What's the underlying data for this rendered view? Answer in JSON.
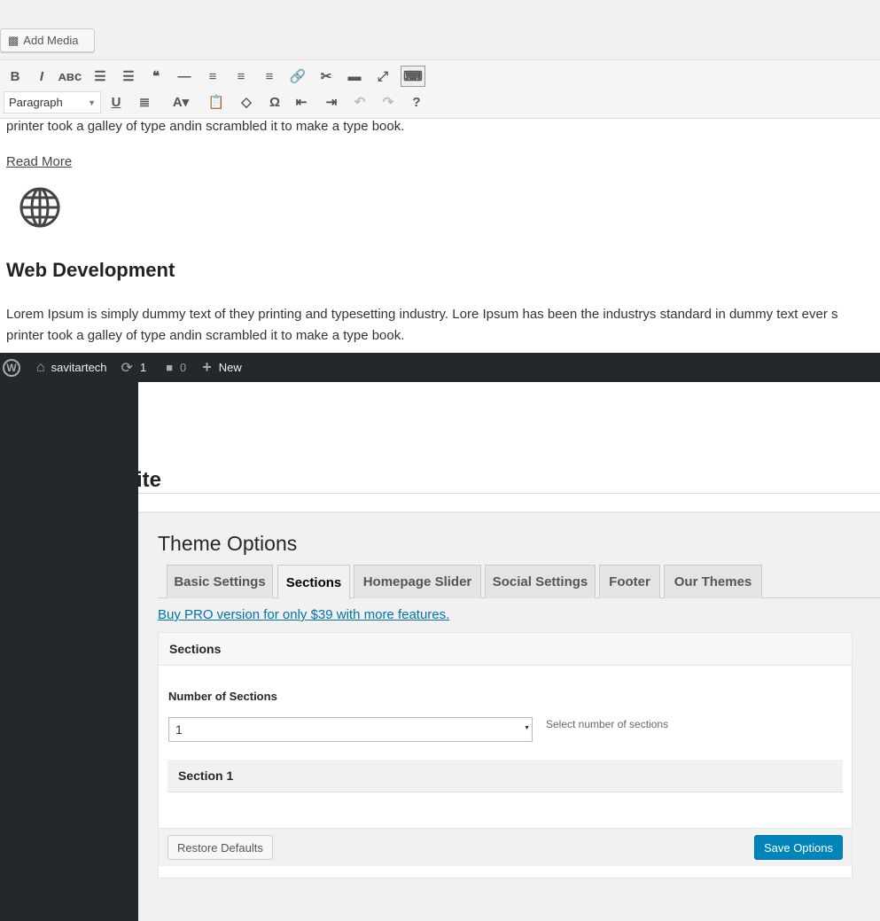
{
  "editor": {
    "add_media": "Add Media",
    "format_select": "Paragraph",
    "toolbar_row1": [
      "bold-icon",
      "italic-icon",
      "strikethrough-icon",
      "bullet-list-icon",
      "numbered-list-icon",
      "blockquote-icon",
      "horizontal-line-icon",
      "align-left-icon",
      "align-center-icon",
      "align-right-icon",
      "link-icon",
      "unlink-icon",
      "read-more-icon",
      "fullscreen-icon",
      "toolbar-toggle-icon"
    ],
    "toolbar_row2": [
      "underline-icon",
      "justify-icon",
      "text-color-icon",
      "paste-text-icon",
      "clear-format-icon",
      "special-char-icon",
      "outdent-icon",
      "indent-icon",
      "undo-icon",
      "redo-icon",
      "help-icon"
    ]
  },
  "content": {
    "line_top": "printer took a galley of type andin scrambled it to make a type book.",
    "read_more": "Read More",
    "heading": "Web Development",
    "para_1": "Lorem Ipsum is simply dummy text of they printing and typesetting industry. Lore Ipsum has been the industrys standard in dummy text ever s",
    "para_2": "printer took a galley of type andin scrambled it to make a type book."
  },
  "adminbar": {
    "site": "savitartech",
    "updates": "1",
    "comments": "0",
    "new": "New"
  },
  "page": {
    "partial_heading": "ite",
    "title": "Theme Options",
    "tabs": [
      "Basic Settings",
      "Sections",
      "Homepage Slider",
      "Social Settings",
      "Footer",
      "Our Themes"
    ],
    "active_tab": "Sections",
    "pro_link": "Buy PRO version for only $39 with more features."
  },
  "panel": {
    "header": "Sections",
    "field_label": "Number of Sections",
    "select_value": "1",
    "field_help": "Select number of sections",
    "section_title": "Section 1",
    "restore": "Restore Defaults",
    "save": "Save Options"
  },
  "colors": {
    "adminbar": "#23282d",
    "link": "#0073aa",
    "primary": "#0085ba"
  }
}
